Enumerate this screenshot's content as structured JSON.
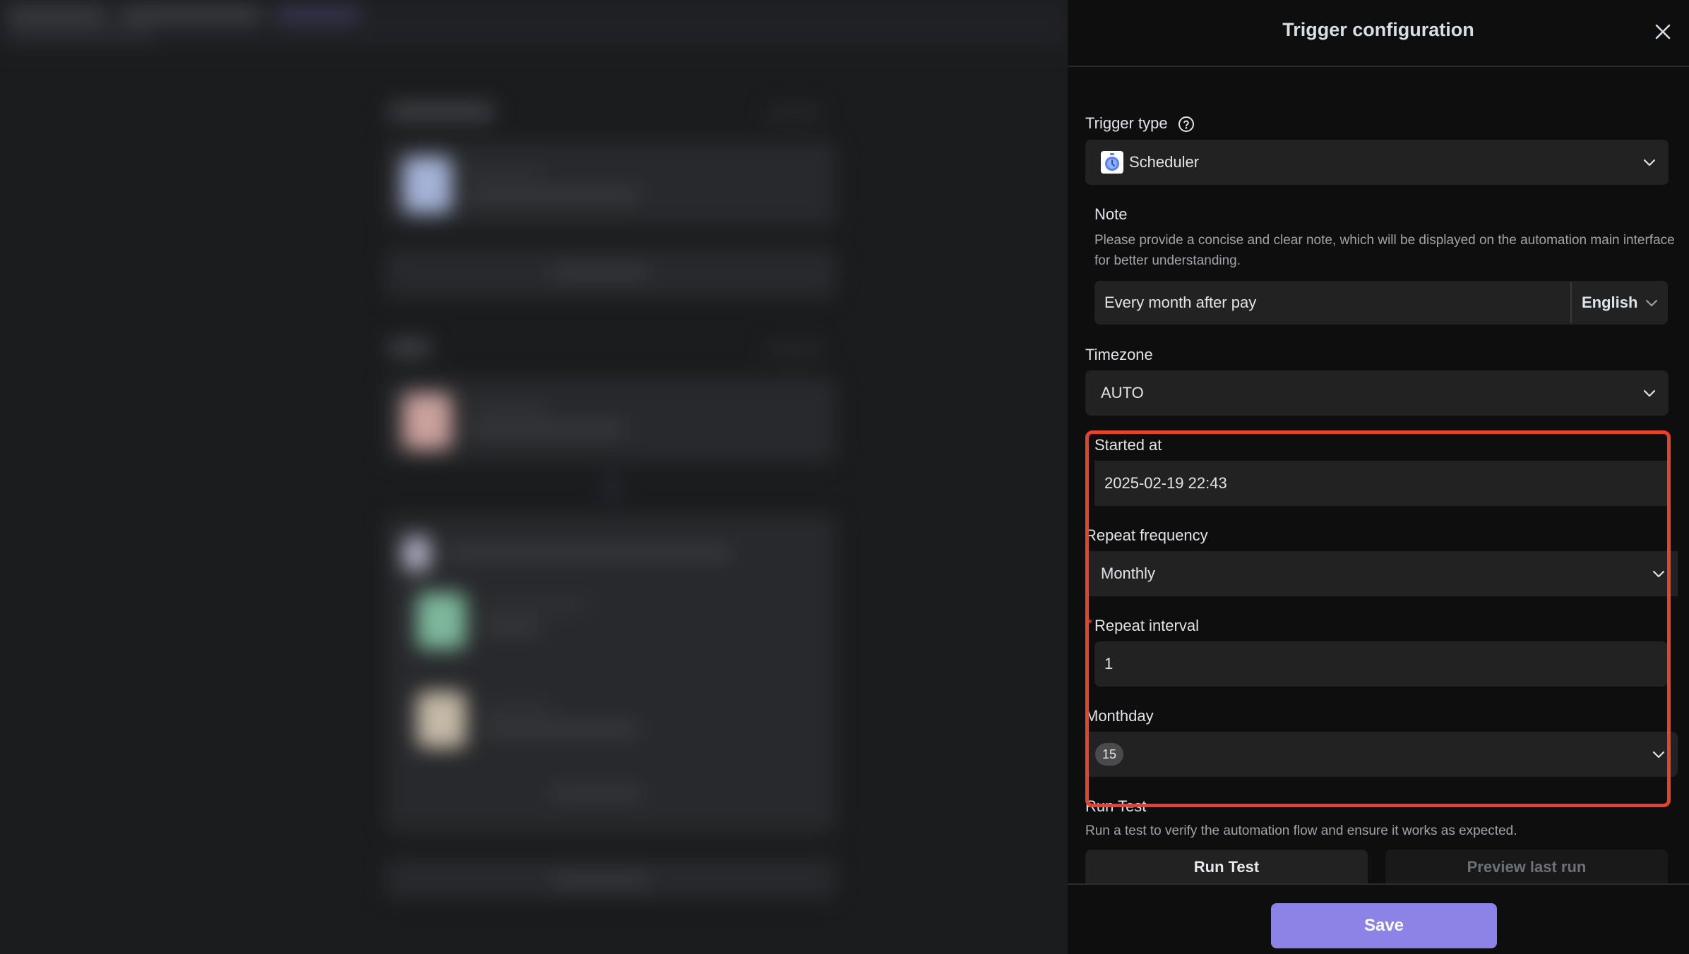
{
  "drawer": {
    "title": "Trigger configuration",
    "close_icon": "close-icon"
  },
  "trigger_type": {
    "label": "Trigger type",
    "help_icon": "help-circle-icon",
    "value": "Scheduler",
    "icon": "stopwatch-icon"
  },
  "note": {
    "label": "Note",
    "description": "Please provide a concise and clear note, which will be displayed on the automation main interface for better understanding.",
    "value": "Every month after pay",
    "language": "English"
  },
  "timezone": {
    "label": "Timezone",
    "value": "AUTO"
  },
  "started_at": {
    "label": "Started at",
    "value": "2025-02-19 22:43"
  },
  "repeat_frequency": {
    "label": "Repeat frequency",
    "value": "Monthly"
  },
  "repeat_interval": {
    "label": "Repeat interval",
    "required_mark": "*",
    "value": "1"
  },
  "monthday": {
    "label": "Monthday",
    "selected": [
      "15"
    ]
  },
  "run_test": {
    "label": "Run Test",
    "description": "Run a test to verify the automation flow and ensure it works as expected.",
    "run_button": "Run Test",
    "preview_button": "Preview last run"
  },
  "footer": {
    "save_label": "Save"
  },
  "colors": {
    "accent": "#8d82e6",
    "highlight": "#e5432a",
    "required": "#e04a3a",
    "panel_bg": "#0e0e0f",
    "field_bg": "#222223"
  }
}
